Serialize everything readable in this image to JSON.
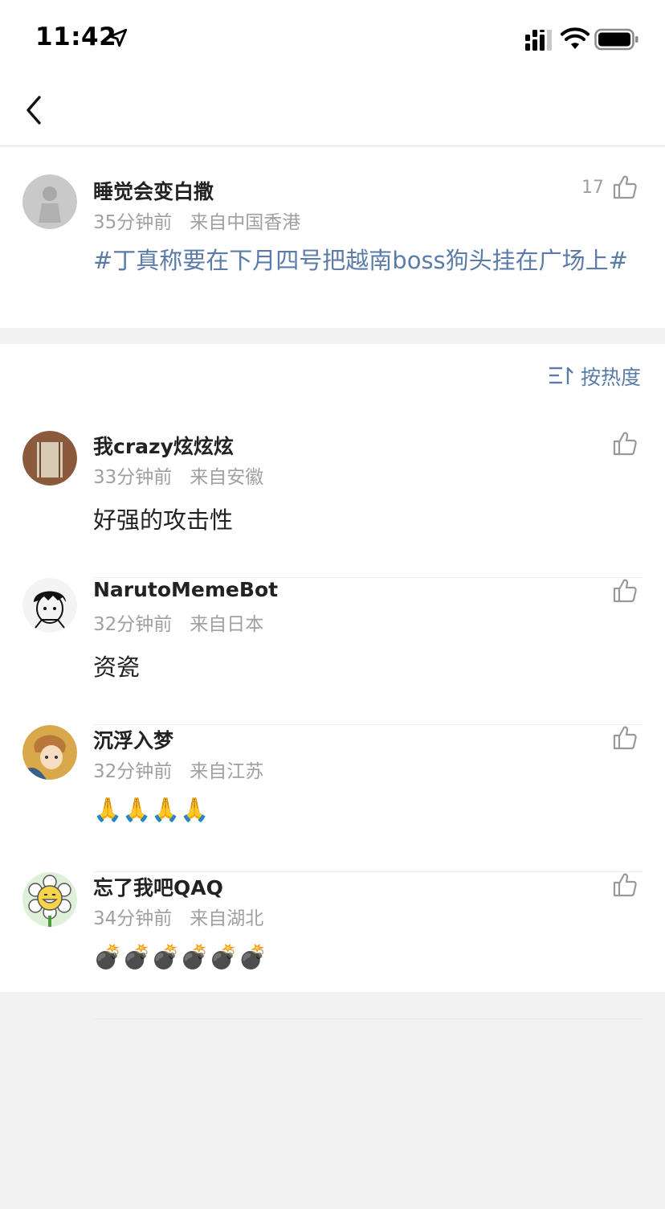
{
  "status_bar": {
    "time": "11:42"
  },
  "post": {
    "username": "睡觉会变白撒",
    "time": "35分钟前",
    "location": "来自中国香港",
    "like_count": "17",
    "text": "#丁真称要在下月四号把越南boss狗头挂在广场上#"
  },
  "sort": {
    "label": "按热度"
  },
  "comments": [
    {
      "username": "我crazy炫炫炫",
      "time": "33分钟前",
      "location": "来自安徽",
      "text": "好强的攻击性"
    },
    {
      "username": "NarutoMemeBot",
      "time": "32分钟前",
      "location": "来自日本",
      "text": "资瓷"
    },
    {
      "username": "沉浮入梦",
      "time": "32分钟前",
      "location": "来自江苏",
      "text": "🙏🙏🙏🙏"
    },
    {
      "username": "忘了我吧QAQ",
      "time": "34分钟前",
      "location": "来自湖北",
      "text": "💣💣💣💣💣💣"
    }
  ],
  "colors": {
    "link": "#5b7ca8",
    "meta": "#a0a0a0",
    "text": "#222222"
  }
}
